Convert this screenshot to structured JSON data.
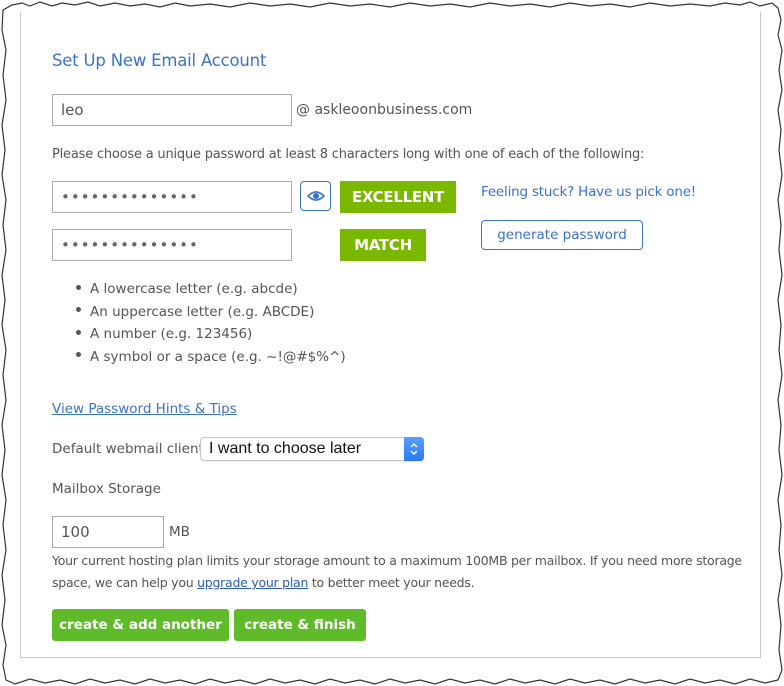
{
  "form": {
    "title": "Set Up New Email Account",
    "username": {
      "value": "leo",
      "placeholder": ""
    },
    "domain_suffix": "@ askleoonbusiness.com",
    "password_instructions": "Please choose a unique password at least 8 characters long with one of each of the following:",
    "password": {
      "masked_value": "••••••••••••••",
      "strength_label": "EXCELLENT"
    },
    "confirm_password": {
      "masked_value": "••••••••••••••",
      "match_label": "MATCH"
    },
    "show_password_icon": "eye-icon",
    "feeling_stuck_text": "Feeling stuck? Have us pick one!",
    "generate_password_label": "generate password",
    "requirements": [
      "A lowercase letter (e.g. abcde)",
      "An uppercase letter (e.g. ABCDE)",
      "A number (e.g. 123456)",
      "A symbol or a space (e.g. ~!@#$%^)"
    ],
    "hints_link": "View Password Hints & Tips",
    "webmail_client": {
      "label": "Default webmail client",
      "selected": "I want to choose later"
    },
    "mailbox_storage": {
      "label": "Mailbox Storage",
      "value": "100",
      "unit": "MB",
      "note_before_link": "Your current hosting plan limits your storage amount to a maximum 100MB per mailbox. If you need more storage space, we can help you ",
      "note_link": "upgrade your plan",
      "note_after_link": " to better meet your needs."
    },
    "buttons": {
      "create_add_another": "create & add another",
      "create_finish": "create & finish"
    }
  },
  "colors": {
    "accent_blue": "#3b73c9",
    "strength_green": "#7ab800",
    "button_green": "#5fbb2a"
  }
}
